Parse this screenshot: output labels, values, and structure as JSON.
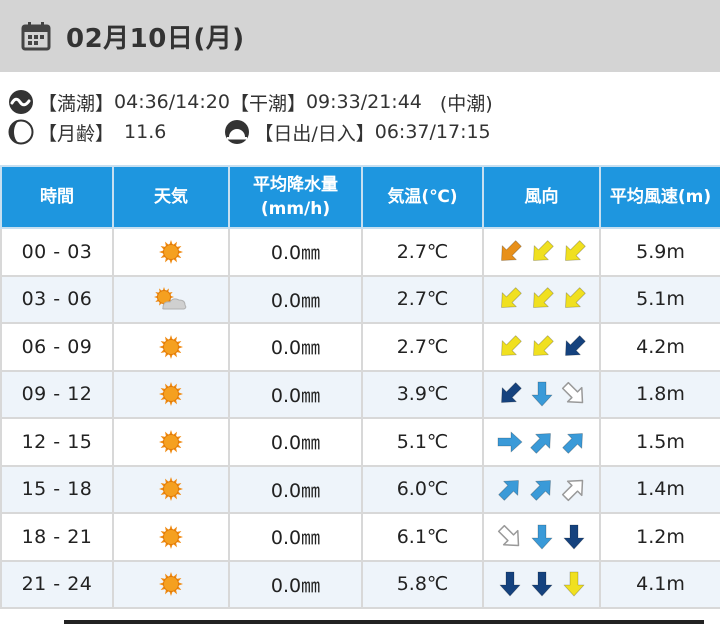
{
  "header": {
    "title": "02月10日(月)"
  },
  "tide": {
    "high_label": "【満潮】",
    "high_times": "04:36/14:20",
    "low_label": "【干潮】",
    "low_times": "09:33/21:44",
    "type": "(中潮)"
  },
  "moon": {
    "label": "【月齢】",
    "value": "11.6"
  },
  "sun": {
    "label": "【日出/日入】",
    "times": "06:37/17:15"
  },
  "table": {
    "headers": {
      "time": "時間",
      "weather": "天気",
      "precip_1": "平均降水量",
      "precip_2": "(mm/h)",
      "temp": "気温(℃)",
      "wind_dir": "風向",
      "wind_speed": "平均風速(m)"
    },
    "rows": [
      {
        "time": "00 - 03",
        "weather": "sunny",
        "precip": "0.0㎜",
        "temp": "2.7℃",
        "winds": [
          {
            "dir": "sw",
            "color": "#e8901a",
            "outline": false
          },
          {
            "dir": "sw",
            "color": "#f0e020",
            "outline": false
          },
          {
            "dir": "sw",
            "color": "#f0e020",
            "outline": false
          }
        ],
        "speed": "5.9m"
      },
      {
        "time": "03 - 06",
        "weather": "sunny-cloudy",
        "precip": "0.0㎜",
        "temp": "2.7℃",
        "winds": [
          {
            "dir": "sw",
            "color": "#f0e020",
            "outline": false
          },
          {
            "dir": "sw",
            "color": "#f0e020",
            "outline": false
          },
          {
            "dir": "sw",
            "color": "#f0e020",
            "outline": false
          }
        ],
        "speed": "5.1m"
      },
      {
        "time": "06 - 09",
        "weather": "sunny",
        "precip": "0.0㎜",
        "temp": "2.7℃",
        "winds": [
          {
            "dir": "sw",
            "color": "#f0e020",
            "outline": false
          },
          {
            "dir": "sw",
            "color": "#f0e020",
            "outline": false
          },
          {
            "dir": "sw",
            "color": "#15427e",
            "outline": false
          }
        ],
        "speed": "4.2m"
      },
      {
        "time": "09 - 12",
        "weather": "sunny",
        "precip": "0.0㎜",
        "temp": "3.9℃",
        "winds": [
          {
            "dir": "sw",
            "color": "#15427e",
            "outline": false
          },
          {
            "dir": "s",
            "color": "#3a9ad8",
            "outline": false
          },
          {
            "dir": "se",
            "color": "#ffffff",
            "outline": true
          }
        ],
        "speed": "1.8m"
      },
      {
        "time": "12 - 15",
        "weather": "sunny",
        "precip": "0.0㎜",
        "temp": "5.1℃",
        "winds": [
          {
            "dir": "e",
            "color": "#3a9ad8",
            "outline": false
          },
          {
            "dir": "ne",
            "color": "#3a9ad8",
            "outline": false
          },
          {
            "dir": "ne",
            "color": "#3a9ad8",
            "outline": false
          }
        ],
        "speed": "1.5m"
      },
      {
        "time": "15 - 18",
        "weather": "sunny",
        "precip": "0.0㎜",
        "temp": "6.0℃",
        "winds": [
          {
            "dir": "ne",
            "color": "#3a9ad8",
            "outline": false
          },
          {
            "dir": "ne",
            "color": "#3a9ad8",
            "outline": false
          },
          {
            "dir": "ne",
            "color": "#ffffff",
            "outline": true
          }
        ],
        "speed": "1.4m"
      },
      {
        "time": "18 - 21",
        "weather": "sunny",
        "precip": "0.0㎜",
        "temp": "6.1℃",
        "winds": [
          {
            "dir": "se",
            "color": "#ffffff",
            "outline": true
          },
          {
            "dir": "s",
            "color": "#3a9ad8",
            "outline": false
          },
          {
            "dir": "s",
            "color": "#15427e",
            "outline": false
          }
        ],
        "speed": "1.2m"
      },
      {
        "time": "21 - 24",
        "weather": "sunny",
        "precip": "0.0㎜",
        "temp": "5.8℃",
        "winds": [
          {
            "dir": "s",
            "color": "#15427e",
            "outline": false
          },
          {
            "dir": "s",
            "color": "#15427e",
            "outline": false
          },
          {
            "dir": "s",
            "color": "#f0e020",
            "outline": false
          }
        ],
        "speed": "4.1m"
      }
    ]
  },
  "icons": {
    "calendar": "calendar-icon",
    "tide": "tide-wave-icon",
    "moon": "moon-phase-icon",
    "sun": "sunrise-icon",
    "sunny": "sun-icon",
    "sunny-cloudy": "sun-cloud-icon"
  }
}
